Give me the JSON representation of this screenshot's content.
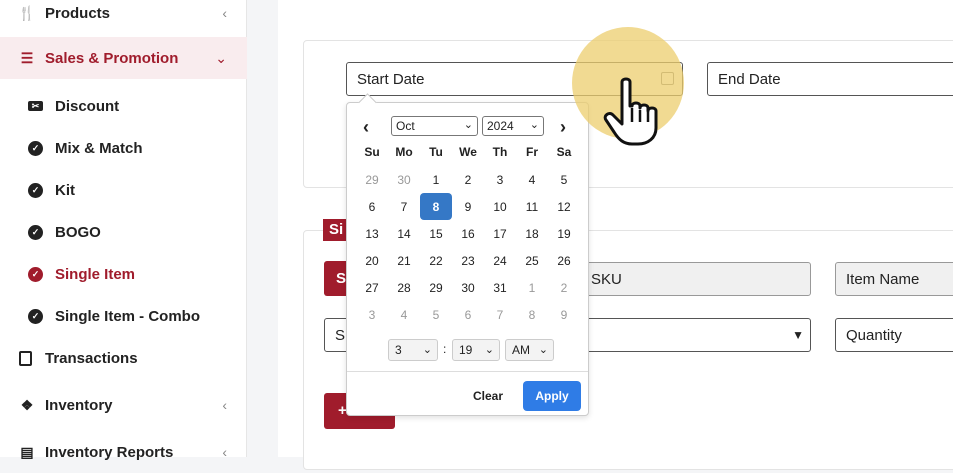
{
  "sidebar": {
    "items": [
      {
        "label": "Products",
        "icon": "utensils-icon",
        "chevron": "‹"
      },
      {
        "label": "Sales & Promotion",
        "icon": "list-icon",
        "chevron": "⌄"
      },
      {
        "label": "Transactions",
        "icon": "clipboard-icon"
      },
      {
        "label": "Inventory",
        "icon": "boxes-icon",
        "chevron": "‹"
      },
      {
        "label": "Inventory Reports",
        "icon": "report-icon",
        "chevron": "‹"
      }
    ],
    "sub_items": [
      {
        "label": "Discount",
        "icon": "ticket-icon"
      },
      {
        "label": "Mix & Match",
        "icon": "check-circle-icon"
      },
      {
        "label": "Kit",
        "icon": "check-circle-icon"
      },
      {
        "label": "BOGO",
        "icon": "check-circle-icon"
      },
      {
        "label": "Single Item",
        "icon": "check-circle-icon",
        "active": true
      },
      {
        "label": "Single Item - Combo",
        "icon": "check-circle-icon"
      }
    ]
  },
  "form": {
    "start_date_placeholder": "Start Date",
    "end_date_placeholder": "End Date",
    "section_tag": "Si",
    "btn_s1": "S",
    "select_s": "S",
    "sku_placeholder": "SKU",
    "item_name_placeholder": "Item Name",
    "quantity_placeholder": "Quantity",
    "add_btn": "+"
  },
  "datepicker": {
    "month": "Oct",
    "year": "2024",
    "prev": "‹",
    "next": "›",
    "dow": [
      "Su",
      "Mo",
      "Tu",
      "We",
      "Th",
      "Fr",
      "Sa"
    ],
    "weeks": [
      [
        "29",
        "30",
        "1",
        "2",
        "3",
        "4",
        "5"
      ],
      [
        "6",
        "7",
        "8",
        "9",
        "10",
        "11",
        "12"
      ],
      [
        "13",
        "14",
        "15",
        "16",
        "17",
        "18",
        "19"
      ],
      [
        "20",
        "21",
        "22",
        "23",
        "24",
        "25",
        "26"
      ],
      [
        "27",
        "28",
        "29",
        "30",
        "31",
        "1",
        "2"
      ],
      [
        "3",
        "4",
        "5",
        "6",
        "7",
        "8",
        "9"
      ]
    ],
    "selected_day": "8",
    "hour": "3",
    "minute": "19",
    "ampm": "AM",
    "time_sep": ":",
    "clear": "Clear",
    "apply": "Apply"
  },
  "colors": {
    "brand": "#a01c2c",
    "apply_blue": "#2f7ce6",
    "selected_day": "#3578c6",
    "highlight": "#ecd06e"
  }
}
